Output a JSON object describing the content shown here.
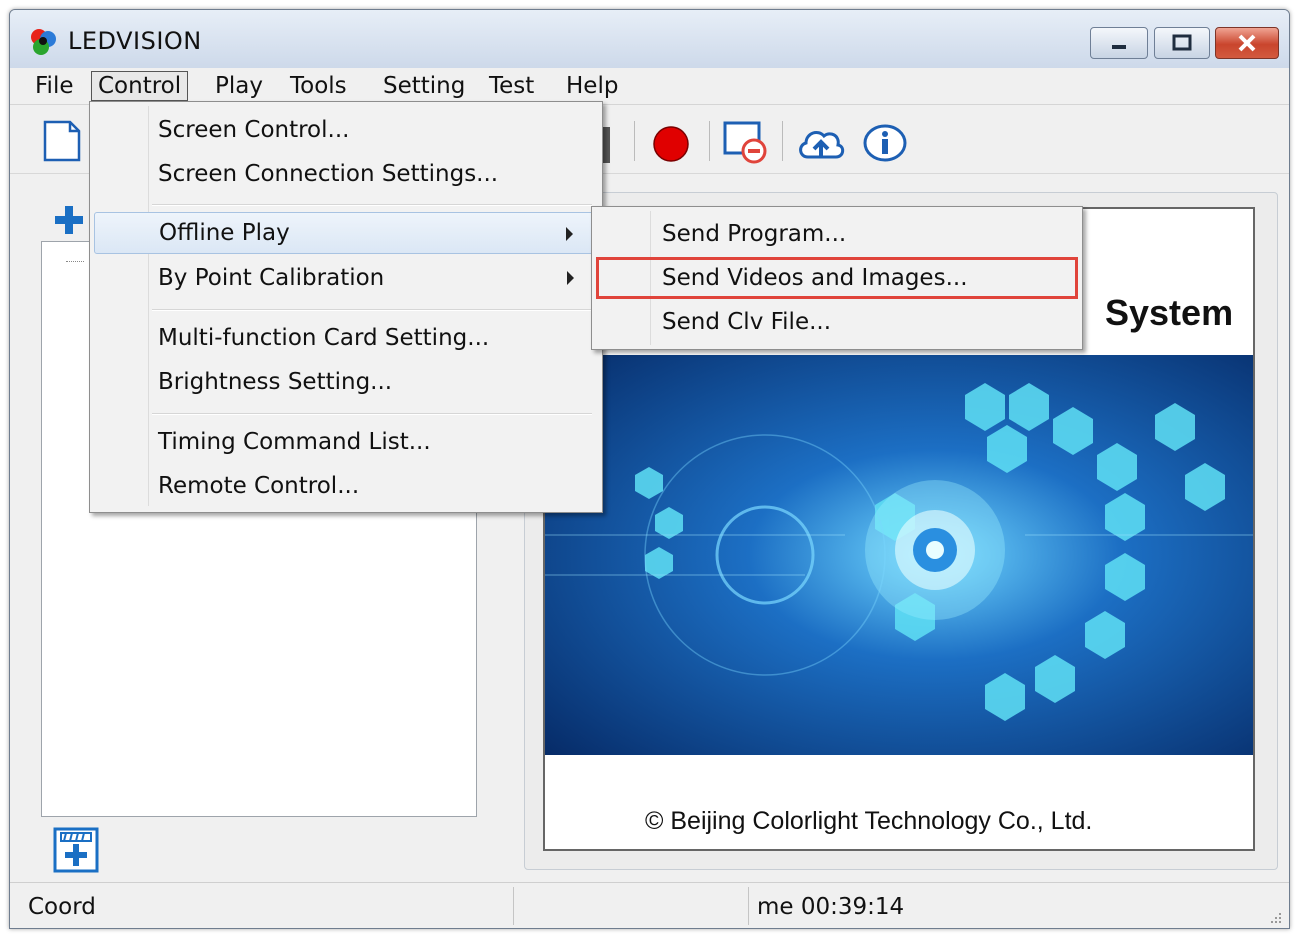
{
  "window": {
    "title": "LEDVISION"
  },
  "menubar": {
    "items": [
      "File",
      "Control",
      "Play",
      "Tools",
      "Setting",
      "Test",
      "Help"
    ]
  },
  "control_menu": {
    "items": [
      {
        "label": "Screen Control..."
      },
      {
        "label": "Screen Connection Settings..."
      },
      {
        "label": "Offline Play",
        "submenu": true
      },
      {
        "label": "By Point Calibration",
        "submenu": true
      },
      {
        "label": "Multi-function Card Setting..."
      },
      {
        "label": "Brightness Setting..."
      },
      {
        "label": "Timing Command List..."
      },
      {
        "label": "Remote Control..."
      }
    ]
  },
  "offline_play_submenu": {
    "items": [
      {
        "label": "Send Program..."
      },
      {
        "label": "Send Videos and Images...",
        "highlighted": true
      },
      {
        "label": "Send Clv File..."
      }
    ]
  },
  "splash": {
    "title_fragment": "System",
    "copyright": "© Beijing Colorlight Technology Co., Ltd."
  },
  "statusbar": {
    "coord": "Coord",
    "time": "me 00:39:14"
  },
  "colors": {
    "highlight_border": "#e0443b",
    "record_button": "#e00000",
    "accent_blue": "#1a6fc4"
  }
}
